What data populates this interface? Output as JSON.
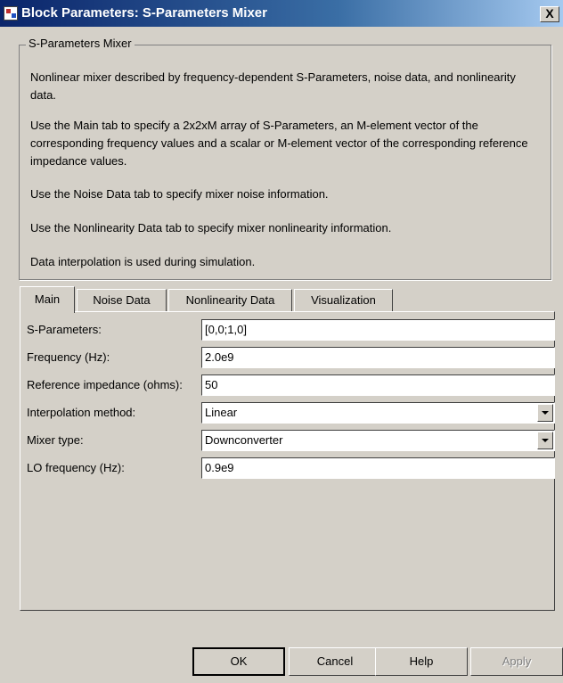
{
  "window": {
    "title": "Block Parameters: S-Parameters Mixer",
    "close_glyph": "X"
  },
  "description": {
    "group_title": "S-Parameters Mixer",
    "paragraphs": [
      "Nonlinear mixer described by frequency-dependent S-Parameters, noise data, and nonlinearity data.",
      "Use the Main tab to specify a 2x2xM array of S-Parameters, an M-element vector of the corresponding frequency values and a scalar or M-element vector of the corresponding reference impedance values.",
      "Use the Noise Data tab to specify mixer noise information.",
      "Use the Nonlinearity Data tab to specify mixer nonlinearity information.",
      "Data interpolation is used during simulation."
    ]
  },
  "tabs": [
    {
      "label": "Main",
      "active": true
    },
    {
      "label": "Noise Data",
      "active": false
    },
    {
      "label": "Nonlinearity Data",
      "active": false
    },
    {
      "label": "Visualization",
      "active": false
    }
  ],
  "params": [
    {
      "label": "S-Parameters:",
      "value": "[0,0;1,0]",
      "kind": "text"
    },
    {
      "label": "Frequency (Hz):",
      "value": "2.0e9",
      "kind": "text"
    },
    {
      "label": "Reference impedance (ohms):",
      "value": "50",
      "kind": "text"
    },
    {
      "label": "Interpolation method:",
      "value": "Linear",
      "kind": "select"
    },
    {
      "label": "Mixer type:",
      "value": "Downconverter",
      "kind": "select"
    },
    {
      "label": "LO frequency (Hz):",
      "value": "0.9e9",
      "kind": "text"
    }
  ],
  "buttons": {
    "ok": "OK",
    "cancel": "Cancel",
    "help": "Help",
    "apply": "Apply"
  }
}
